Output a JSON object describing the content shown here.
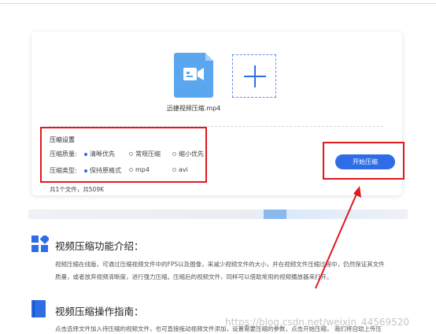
{
  "file": {
    "name": "迅捷视频压缩.mp4"
  },
  "settings": {
    "title": "压缩设置",
    "quality": {
      "label": "压缩质量:",
      "options": [
        {
          "label": "清晰优先",
          "selected": true
        },
        {
          "label": "常规压缩",
          "selected": false
        },
        {
          "label": "缩小优先",
          "selected": false
        }
      ]
    },
    "type": {
      "label": "压缩类型:",
      "options": [
        {
          "label": "保持原格式",
          "selected": true
        },
        {
          "label": "mp4",
          "selected": false
        },
        {
          "label": "avi",
          "selected": false
        }
      ]
    }
  },
  "start_button": "开始压缩",
  "summary": "共1个文件，共509K",
  "intro": {
    "title": "视频压缩功能介绍：",
    "text_line1": "视频压缩在线版，可通过压缩视频文件中的FPS以及图像，来减少视频文件的大小，并在视频文件压缩过程中，仍然保证其文件",
    "text_line2": "质量，或者放弃视频清晰度，进行强力压缩。压缩后的视频文件，同样可以借助常用的视频播放器来打开。"
  },
  "guide": {
    "title": "视频压缩操作指南：",
    "text_line1": "点击选择文件加入待压缩的视频文件，也可直接拖动视频文件添加，设置需要压缩的参数，点击开始压缩，  我们将自动上传压"
  },
  "watermark": "https://blog.csdn.net/weixin_44569520",
  "colors": {
    "accent": "#2f6de8",
    "highlight": "#e0191f",
    "file_icon": "#5ba7ef"
  }
}
